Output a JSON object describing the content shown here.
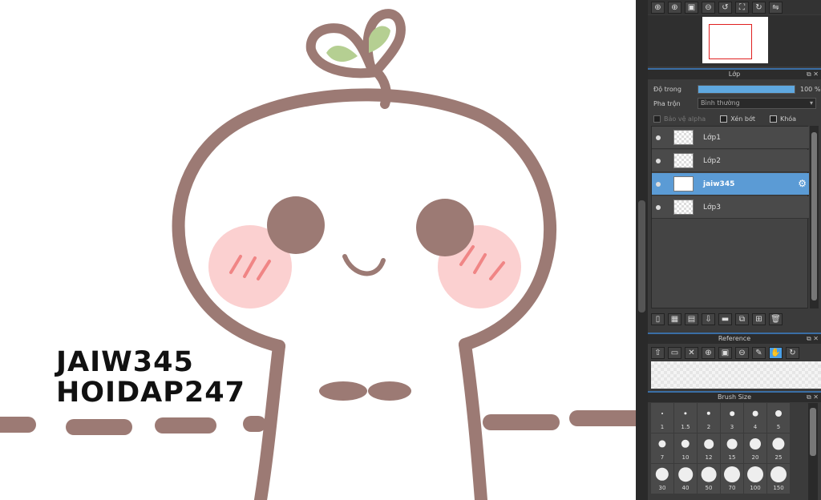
{
  "canvas": {
    "signature_line1": "JAIW345",
    "signature_line2": "HOIDAP247"
  },
  "top_toolbar": [
    "zoom-in-icon",
    "zoom-in-alt-icon",
    "fit-icon",
    "zoom-out-icon",
    "rotate-left-icon",
    "fullscreen-icon",
    "rotate-right-icon",
    "flip-icon"
  ],
  "layer_panel": {
    "title": "Lớp",
    "opacity_label": "Độ trong",
    "opacity_value": "100 %",
    "opacity_fraction": 1.0,
    "blend_label": "Pha trộn",
    "blend_value": "Bình thường",
    "protect_alpha": "Bảo vệ alpha",
    "clipping": "Xén bớt",
    "lock": "Khóa",
    "layers": [
      {
        "name": "Lớp1",
        "selected": false
      },
      {
        "name": "Lớp2",
        "selected": false
      },
      {
        "name": "jaiw345",
        "selected": true
      },
      {
        "name": "Lớp3",
        "selected": false
      }
    ]
  },
  "reference_panel": {
    "title": "Reference"
  },
  "brush_panel": {
    "title": "Brush Size",
    "sizes": [
      "1",
      "1.5",
      "2",
      "3",
      "4",
      "5",
      "7",
      "10",
      "12",
      "15",
      "20",
      "25",
      "30",
      "40",
      "50",
      "70",
      "100",
      "150"
    ]
  },
  "colors": {
    "accent": "#5b9bd5",
    "stroke": "#9c7a74",
    "cheek": "#fbd0d0",
    "leaf": "#b5cf92"
  }
}
